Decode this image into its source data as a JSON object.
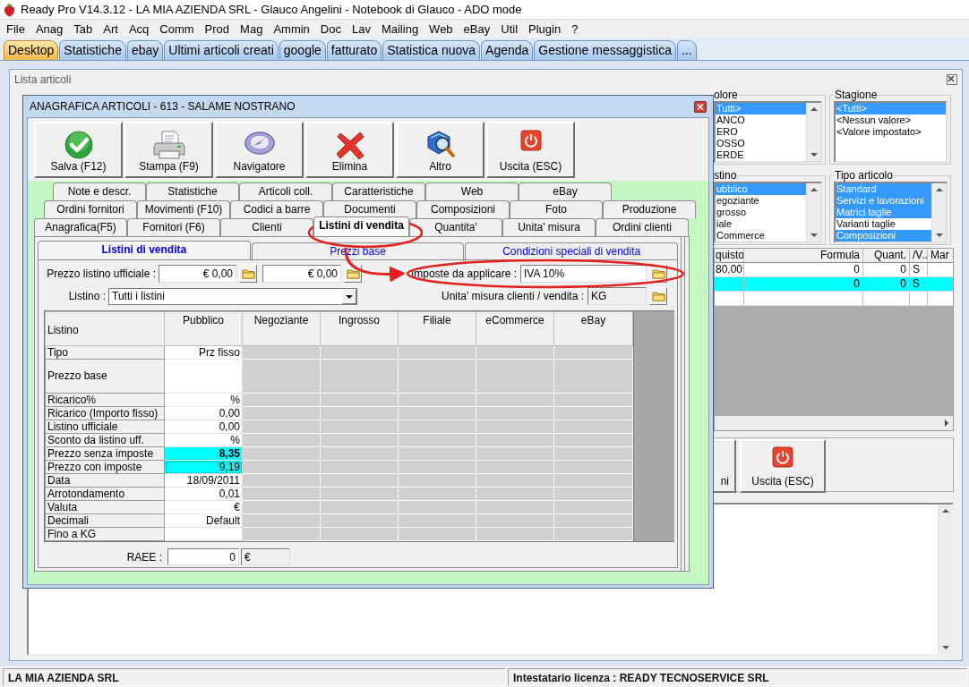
{
  "window": {
    "title": "Ready Pro V14.3.12 - LA MIA AZIENDA SRL - Glauco Angelini - Notebook di Glauco - ADO mode"
  },
  "menu": [
    "File",
    "Anag",
    "Tab",
    "Art",
    "Acq",
    "Comm",
    "Prod",
    "Mag",
    "Ammin",
    "Doc",
    "Lav",
    "Mailing",
    "Web",
    "eBay",
    "Util",
    "Plugin",
    "?"
  ],
  "tabs": [
    {
      "label": "Desktop",
      "selected": true
    },
    {
      "label": "Statistiche",
      "selected": false
    },
    {
      "label": "ebay",
      "selected": false
    },
    {
      "label": "Ultimi articoli creati",
      "selected": false
    },
    {
      "label": "google",
      "selected": false
    },
    {
      "label": "fatturato",
      "selected": false
    },
    {
      "label": "Statistica nuova",
      "selected": false
    },
    {
      "label": "Agenda",
      "selected": false
    },
    {
      "label": "Gestione messaggistica",
      "selected": false
    },
    {
      "label": "...",
      "selected": false
    }
  ],
  "lista_articoli": {
    "title": "Lista articoli",
    "filters": [
      {
        "label": "olore",
        "items": [
          {
            "label": "Tutti>",
            "selected": true
          },
          {
            "label": "ANCO",
            "selected": false
          },
          {
            "label": "ERO",
            "selected": false
          },
          {
            "label": "OSSO",
            "selected": false
          },
          {
            "label": "ERDE",
            "selected": false
          }
        ]
      },
      {
        "label": "Stagione",
        "items": [
          {
            "label": "<Tutti>",
            "selected": true
          },
          {
            "label": "<Nessun valore>",
            "selected": false
          },
          {
            "label": "<Valore impostato>",
            "selected": false
          }
        ]
      },
      {
        "label": "stino",
        "items": [
          {
            "label": "ubblico",
            "selected": true
          },
          {
            "label": "egoziante",
            "selected": false
          },
          {
            "label": "grosso",
            "selected": false
          },
          {
            "label": "iale",
            "selected": false
          },
          {
            "label": "Commerce",
            "selected": false
          }
        ]
      },
      {
        "label": "Tipo articolo",
        "items": [
          {
            "label": "Standard",
            "selected": true
          },
          {
            "label": "Servizi e lavorazioni",
            "selected": true
          },
          {
            "label": "Matrici taglie",
            "selected": true
          },
          {
            "label": "Varianti taglie",
            "selected": false
          },
          {
            "label": "Composizioni",
            "selected": true
          }
        ]
      }
    ],
    "grid": {
      "columns": [
        "quisto",
        "Formula",
        "Quant.",
        "/V..",
        "Mar"
      ],
      "rows": [
        {
          "cells": [
            "80,00",
            "0",
            "0",
            "S",
            null
          ],
          "selected": false
        },
        {
          "cells": [
            null,
            "0",
            "0",
            "S",
            null
          ],
          "selected": true
        }
      ]
    },
    "buttons": [
      {
        "label": "ni",
        "kind": "plain"
      },
      {
        "label": "Uscita (ESC)",
        "kind": "power"
      }
    ]
  },
  "dialog": {
    "title": "ANAGRAFICA ARTICOLI - 613 - SALAME NOSTRANO",
    "toolbar": [
      {
        "label": "Salva (F12)",
        "kind": "check"
      },
      {
        "label": "Stampa (F9)",
        "kind": "printer"
      },
      {
        "label": "Navigatore",
        "kind": "compass"
      },
      {
        "label": "Elimina",
        "kind": "cross"
      },
      {
        "label": "Altro",
        "kind": "magnifier"
      },
      {
        "label": "Uscita (ESC)",
        "kind": "power"
      }
    ],
    "tab_rows": [
      {
        "tabs": [
          {
            "label": "Note e descr.",
            "selected": false
          },
          {
            "label": "Statistiche",
            "selected": false
          },
          {
            "label": "Articoli coll.",
            "selected": false
          },
          {
            "label": "Caratteristiche",
            "selected": false
          },
          {
            "label": "Web",
            "selected": false
          },
          {
            "label": "eBay",
            "selected": false
          }
        ]
      },
      {
        "tabs": [
          {
            "label": "Ordini fornitori",
            "selected": false
          },
          {
            "label": "Movimenti (F10)",
            "selected": false
          },
          {
            "label": "Codici a barre",
            "selected": false
          },
          {
            "label": "Documenti",
            "selected": false
          },
          {
            "label": "Composizioni",
            "selected": false
          },
          {
            "label": "Foto",
            "selected": false
          },
          {
            "label": "Produzione",
            "selected": false
          }
        ]
      },
      {
        "tabs": [
          {
            "label": "Anagrafica(F5)",
            "selected": false
          },
          {
            "label": "Fornitori (F6)",
            "selected": false
          },
          {
            "label": "Clienti",
            "selected": false
          },
          {
            "label": "Listini di vendita",
            "selected": true
          },
          {
            "label": "Quantita'",
            "selected": false
          },
          {
            "label": "Unita' misura",
            "selected": false
          },
          {
            "label": "Ordini clienti",
            "selected": false
          }
        ]
      }
    ],
    "subtabs": [
      {
        "label": "Listini di vendita",
        "selected": true
      },
      {
        "label": "Prezzi base",
        "selected": false
      },
      {
        "label": "Condizioni speciali di vendita",
        "selected": false
      }
    ],
    "official_price": {
      "label": "Prezzo listino ufficiale :",
      "values": [
        "€ 0,00",
        "€ 0,00"
      ]
    },
    "taxes": {
      "label": "Imposte da applicare :",
      "value": "IVA 10%"
    },
    "listino": {
      "label": "Listino :",
      "value": "Tutti i listini"
    },
    "unit": {
      "label": "Unita' misura clienti / vendita :",
      "value": "KG"
    },
    "grid": {
      "columns": [
        "Listino",
        "Pubblico",
        "Negoziante",
        "Ingrosso",
        "Filiale",
        "eCommerce",
        "eBay"
      ],
      "rows": [
        {
          "label": "Tipo",
          "value": "Prz fisso",
          "kind": "line",
          "highlighted": false,
          "focused": false,
          "bold": false
        },
        {
          "label": "Prezzo base",
          "kind": "multiline",
          "highlighted": false,
          "focused": false
        },
        {
          "label": "Ricarico%",
          "value": "%",
          "kind": "line",
          "highlighted": false,
          "focused": false,
          "bold": false
        },
        {
          "label": "Ricarico (Importo fisso)",
          "value": "0,00",
          "kind": "line",
          "highlighted": false,
          "focused": false,
          "bold": false
        },
        {
          "label": "Listino ufficiale",
          "value": "0,00",
          "kind": "line",
          "highlighted": false,
          "focused": false,
          "bold": false
        },
        {
          "label": "Sconto da listino uff.",
          "value": "%",
          "kind": "line",
          "highlighted": false,
          "focused": false,
          "bold": false
        },
        {
          "label": "Prezzo senza imposte",
          "value": "8,35",
          "kind": "line",
          "highlighted": true,
          "focused": false,
          "bold": true
        },
        {
          "label": "Prezzo con imposte",
          "value": "9,19",
          "kind": "line",
          "highlighted": true,
          "focused": true,
          "bold": false
        },
        {
          "label": "Data",
          "value": "18/09/2011",
          "kind": "line",
          "highlighted": false,
          "focused": false,
          "bold": false
        },
        {
          "label": "Arrotondamento",
          "value": "0,01",
          "kind": "line",
          "highlighted": false,
          "focused": false,
          "bold": false
        },
        {
          "label": "Valuta",
          "value": "€",
          "kind": "line",
          "highlighted": false,
          "focused": false,
          "bold": false
        },
        {
          "label": "Decimali",
          "value": "Default",
          "kind": "line",
          "highlighted": false,
          "focused": false,
          "bold": false
        },
        {
          "label": "Fino a KG",
          "kind": "line",
          "highlighted": false,
          "focused": false
        }
      ]
    },
    "raee": {
      "label": "RAEE :",
      "value": "0",
      "unit": "€"
    }
  },
  "status_bar": [
    "LA MIA AZIENDA SRL",
    "Intestatario licenza : READY TECNOSERVICE SRL"
  ]
}
